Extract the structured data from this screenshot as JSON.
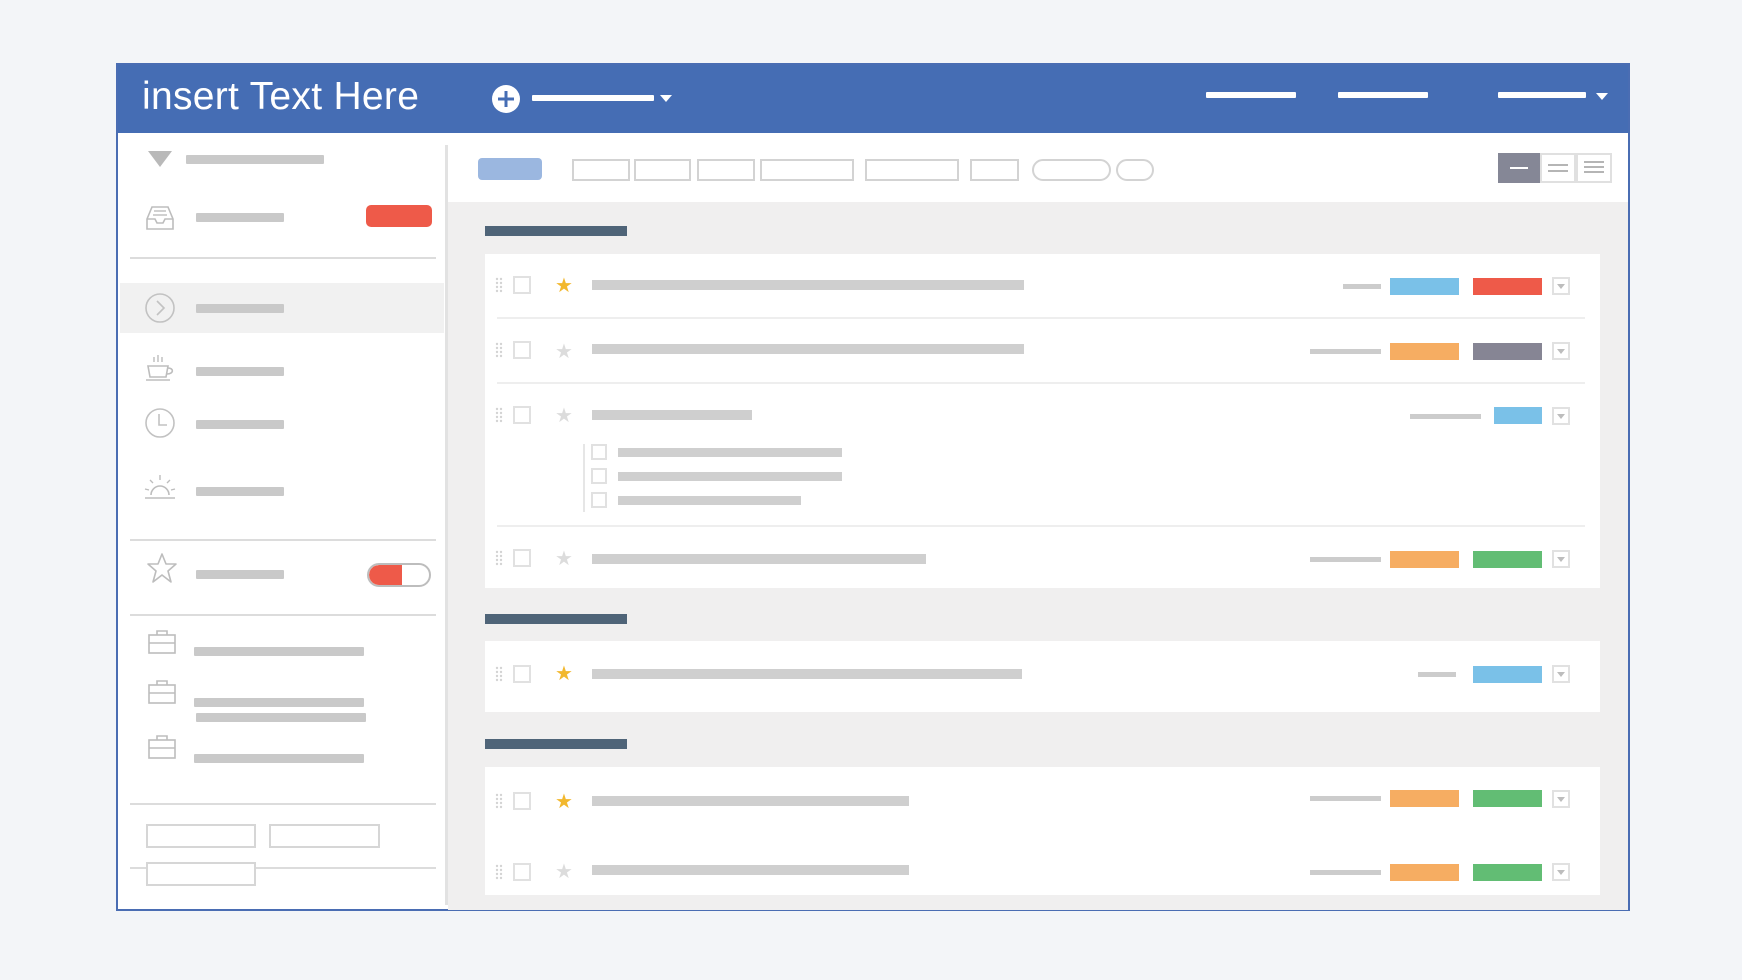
{
  "app": {
    "title": "insert Text Here"
  },
  "colors": {
    "header": "#456db4",
    "accent_red": "#ee5a49",
    "tag_blue": "#7ac1e8",
    "tag_red": "#ee5a49",
    "tag_orange": "#f6ad62",
    "tag_gray": "#868594",
    "tag_green": "#62bd74",
    "star_active": "#f2b82e",
    "star_inactive": "#dcdcdc"
  },
  "icons": {
    "add": "plus-circle-icon",
    "filter": "filter-triangle-icon",
    "inbox": "inbox-tray-icon",
    "next": "chevron-right-circle-icon",
    "coffee": "coffee-cup-icon",
    "clock": "clock-icon",
    "sunrise": "sunrise-icon",
    "star": "star-icon",
    "briefcase": "briefcase-icon"
  },
  "sidebar": {
    "favorites_toggle_on": true
  },
  "view_modes": [
    "compact",
    "normal",
    "expanded"
  ],
  "selected_view": "compact",
  "groups": [
    {
      "rows": [
        {
          "starred": true,
          "tags": [
            "tag_blue",
            "tag_red"
          ]
        },
        {
          "starred": false,
          "tags": [
            "tag_orange",
            "tag_gray"
          ]
        },
        {
          "starred": false,
          "tags": [
            "tag_blue"
          ],
          "subtasks": 3
        },
        {
          "starred": false,
          "tags": [
            "tag_orange",
            "tag_green"
          ]
        }
      ]
    },
    {
      "rows": [
        {
          "starred": true,
          "tags": [
            "tag_blue"
          ]
        }
      ]
    },
    {
      "rows": [
        {
          "starred": true,
          "tags": [
            "tag_orange",
            "tag_green"
          ]
        },
        {
          "starred": false,
          "tags": [
            "tag_orange",
            "tag_green"
          ]
        }
      ]
    }
  ]
}
